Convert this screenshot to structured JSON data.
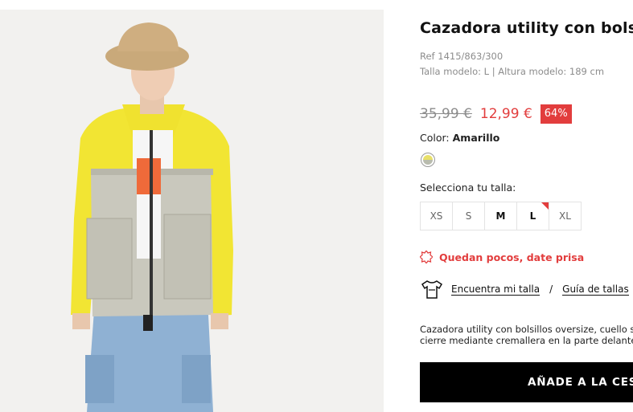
{
  "product": {
    "title": "Cazadora utility con bolsillos",
    "ref": "Ref 1415/863/300",
    "model_info": "Talla modelo: L | Altura modelo: 189 cm",
    "old_price": "35,99 €",
    "new_price": "12,99 €",
    "discount": "64%",
    "color_label": "Color:",
    "color_value": "Amarillo",
    "size_label": "Selecciona tu talla:",
    "sizes": [
      "XS",
      "S",
      "M",
      "L",
      "XL"
    ],
    "stock_message": "Quedan pocos, date prisa",
    "find_size_link": "Encuentra mi talla",
    "size_separator": "/",
    "size_guide_link": "Guía de tallas",
    "description_line1": "Cazadora utility con bolsillos oversize, cuello s",
    "description_line2": "cierre mediante cremallera en la parte delante",
    "add_to_cart": "AÑADE A LA CESTA"
  },
  "colors": {
    "accent": "#e23d3d",
    "cta_background": "#000000",
    "muted_text": "#8c8c8c"
  },
  "icons": {
    "hot": "hot-badge-icon",
    "tshirt": "tshirt-measure-icon",
    "swatch": "color-swatch"
  }
}
